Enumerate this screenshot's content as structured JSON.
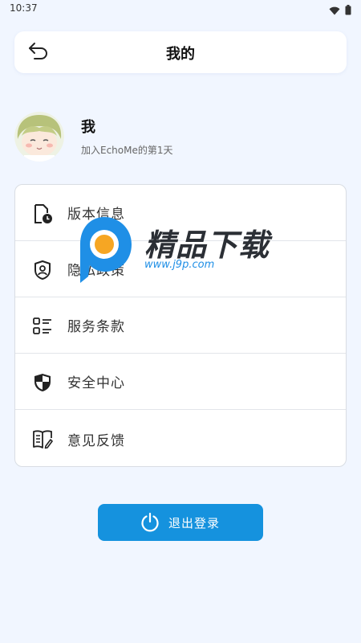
{
  "status_bar": {
    "time": "10:37",
    "icons": [
      "wifi-icon",
      "battery-icon"
    ]
  },
  "header": {
    "title": "我的",
    "back_icon": "back-arrow-icon"
  },
  "profile": {
    "name": "我",
    "subtitle": "加入EchoMe的第1天"
  },
  "menu": {
    "items": [
      {
        "label": "版本信息",
        "icon": "version-info-icon"
      },
      {
        "label": "隐私政策",
        "icon": "privacy-shield-icon"
      },
      {
        "label": "服务条款",
        "icon": "terms-list-icon"
      },
      {
        "label": "安全中心",
        "icon": "security-shield-icon"
      },
      {
        "label": "意见反馈",
        "icon": "feedback-book-icon"
      }
    ]
  },
  "watermark": {
    "brand": "精品下载",
    "url": "www.j9p.com"
  },
  "logout": {
    "label": "退出登录",
    "icon": "power-icon"
  },
  "colors": {
    "background": "#f1f6ff",
    "accent": "#1592de",
    "card": "#ffffff"
  }
}
